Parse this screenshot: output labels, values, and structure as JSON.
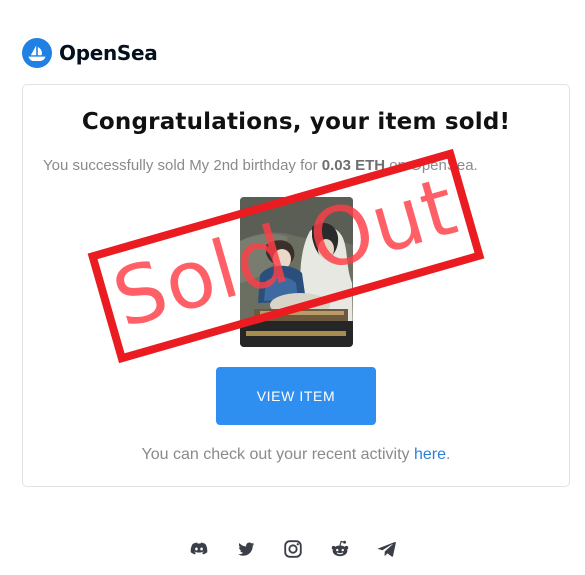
{
  "brand": {
    "name": "OpenSea",
    "accent": "#2081e2"
  },
  "email": {
    "title": "Congratulations, your item sold!",
    "message_prefix": "You successfully sold My 2nd birthday for ",
    "price": "0.03 ETH",
    "message_suffix": " on OpenSea.",
    "button_label": "VIEW ITEM",
    "activity_prefix": "You can check out your recent activity ",
    "activity_link": "here",
    "activity_suffix": "."
  },
  "stamp": {
    "text": "Sold Out",
    "color": "#ea1b21"
  },
  "social": [
    "discord-icon",
    "twitter-icon",
    "instagram-icon",
    "reddit-icon",
    "telegram-icon"
  ],
  "colors": {
    "button": "#2f8ff0",
    "link": "#2f7fd6",
    "muted_text": "#8a8a8a"
  }
}
